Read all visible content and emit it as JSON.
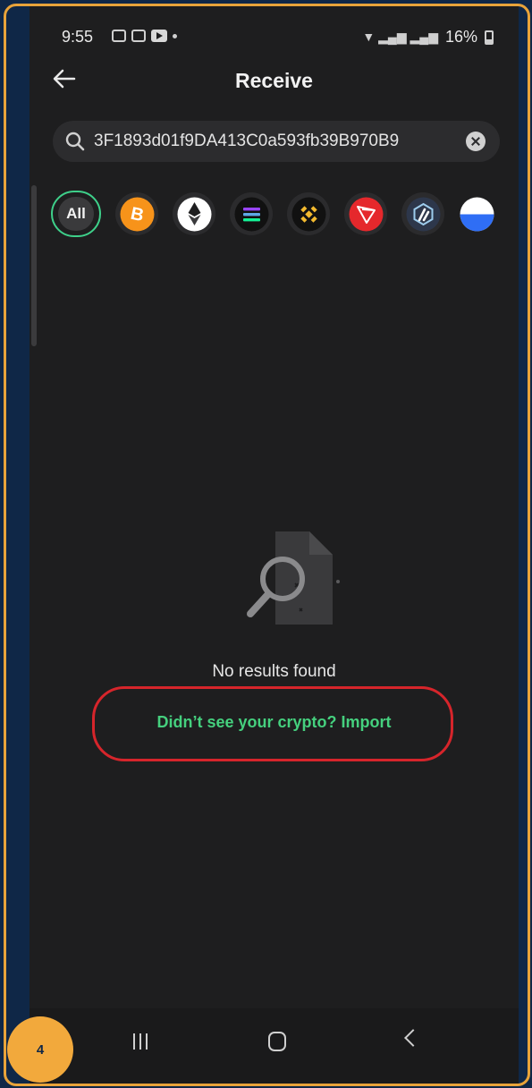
{
  "status_bar": {
    "time": "9:55",
    "battery": "16%"
  },
  "header": {
    "title": "Receive"
  },
  "search": {
    "value": "3F1893d01f9DA413C0a593fb39B970B9"
  },
  "chips": [
    {
      "label": "All",
      "selected": true
    },
    {
      "icon": "bitcoin-icon",
      "color": "#f7931a"
    },
    {
      "icon": "ethereum-icon",
      "color": "#ffffff"
    },
    {
      "icon": "solana-icon",
      "color": "#111111"
    },
    {
      "icon": "bnb-icon",
      "color": "#f3ba2f"
    },
    {
      "icon": "tron-icon",
      "color": "#e5282c"
    },
    {
      "icon": "arbitrum-icon",
      "color": "#2d374b"
    },
    {
      "icon": "half-circle-icon",
      "color": "#2f6ef5"
    }
  ],
  "empty_state": {
    "message": "No results found",
    "import_link": "Didn’t see your crypto? Import"
  },
  "step_badge": "4",
  "colors": {
    "accent": "#45d07e",
    "highlight": "#d6252b",
    "frame": "#e8a33a"
  }
}
